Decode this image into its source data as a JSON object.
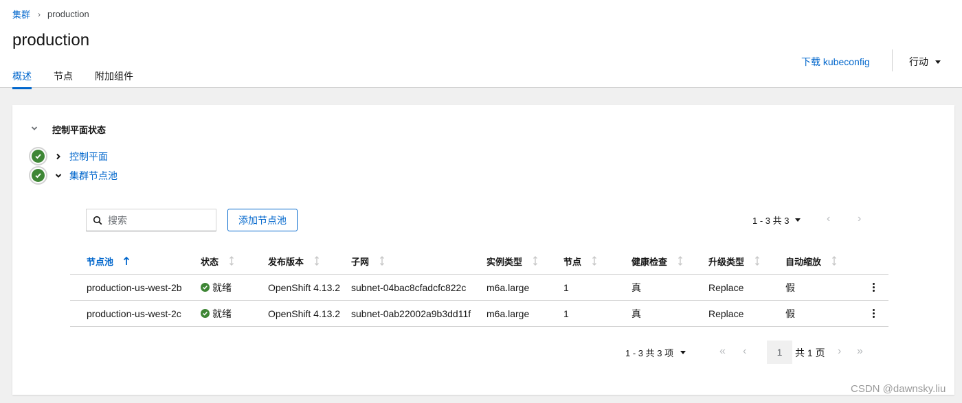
{
  "breadcrumb": {
    "root": "集群",
    "current": "production"
  },
  "page_title": "production",
  "tabs": [
    {
      "label": "概述",
      "active": true
    },
    {
      "label": "节点",
      "active": false
    },
    {
      "label": "附加组件",
      "active": false
    }
  ],
  "header_actions": {
    "download_label": "下载 kubeconfig",
    "actions_label": "行动"
  },
  "control_plane": {
    "section_title": "控制平面状态",
    "items": [
      {
        "label": "控制平面",
        "status": "ok",
        "expanded": false
      },
      {
        "label": "集群节点池",
        "status": "ok",
        "expanded": true
      }
    ]
  },
  "toolbar": {
    "search_placeholder": "搜索",
    "search_value": "",
    "add_button_label": "添加节点池",
    "pagination_label": "1 - 3 共 3"
  },
  "table": {
    "columns": [
      "节点池",
      "状态",
      "发布版本",
      "子网",
      "实例类型",
      "节点",
      "健康检查",
      "升级类型",
      "自动缩放"
    ],
    "rows": [
      {
        "name": "production-us-west-2b",
        "status": "就绪",
        "release": "OpenShift 4.13.2",
        "subnet": "subnet-04bac8cfadcfc822c",
        "instance_type": "m6a.large",
        "nodes": "1",
        "health_check": "真",
        "upgrade_type": "Replace",
        "autoscaling": "假"
      },
      {
        "name": "production-us-west-2c",
        "status": "就绪",
        "release": "OpenShift 4.13.2",
        "subnet": "subnet-0ab22002a9b3dd11f",
        "instance_type": "m6a.large",
        "nodes": "1",
        "health_check": "真",
        "upgrade_type": "Replace",
        "autoscaling": "假"
      }
    ]
  },
  "pagination": {
    "range_label": "1 - 3 共 3 项",
    "current_page": "1",
    "total_label": "共 1 页"
  },
  "watermark": "CSDN @dawnsky.liu",
  "colors": {
    "accent": "#0066cc",
    "success": "#3e8635",
    "border": "#d2d2d2",
    "background": "#f0f0f0"
  }
}
